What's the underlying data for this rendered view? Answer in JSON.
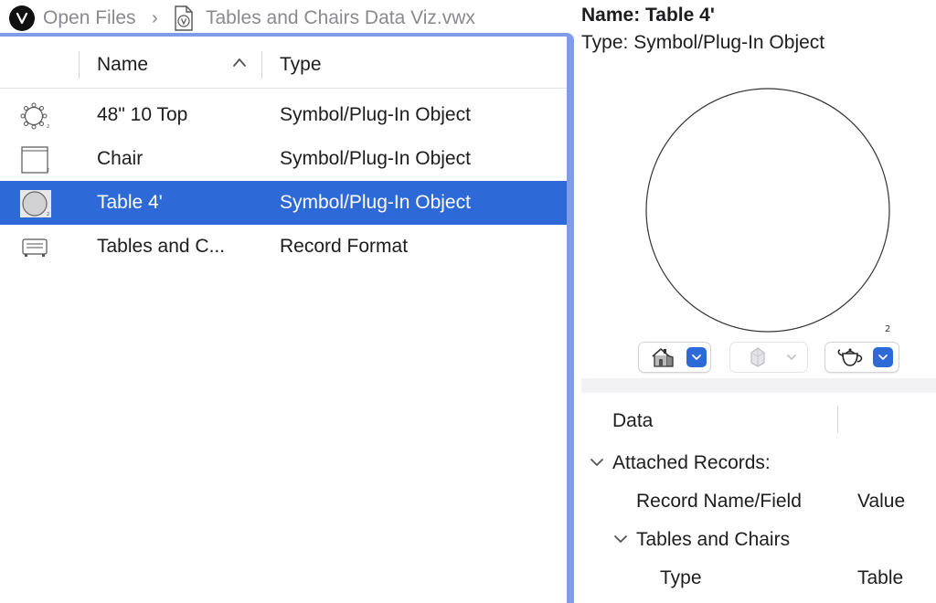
{
  "breadcrumb": {
    "root_label": "Open Files",
    "separator": "›",
    "file_name": "Tables and Chairs Data Viz.vwx"
  },
  "list": {
    "columns": {
      "name": "Name",
      "type": "Type"
    },
    "sort": "ascending",
    "rows": [
      {
        "icon": "round-table-icon",
        "name": "48\" 10 Top",
        "type": "Symbol/Plug-In Object"
      },
      {
        "icon": "chair-symbol-icon",
        "name": "Chair",
        "type": "Symbol/Plug-In Object"
      },
      {
        "icon": "circle-symbol-icon",
        "name": "Table 4'",
        "type": "Symbol/Plug-In Object",
        "selected": true
      },
      {
        "icon": "record-format-icon",
        "name": "Tables and C...",
        "type": "Record Format"
      }
    ]
  },
  "preview": {
    "name_line": "Name: Table 4'",
    "type_line": "Type: Symbol/Plug-In Object",
    "corner_mark": "2",
    "view_controls": [
      "house-view-icon",
      "gem-render-icon",
      "teapot-render-icon"
    ]
  },
  "data_panel": {
    "header": "Data",
    "attached_records_label": "Attached Records:",
    "col_record": "Record Name/Field",
    "col_value": "Value",
    "record_name": "Tables and Chairs",
    "field_name": "Type",
    "field_value": "Table"
  },
  "colors": {
    "selection": "#2d6ad8",
    "panel_border": "#7f9ce8",
    "muted_text": "#8a8a8e"
  }
}
